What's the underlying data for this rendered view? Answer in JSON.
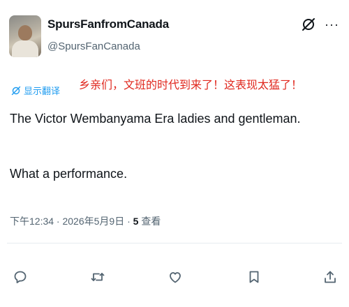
{
  "author": {
    "display_name": "SpursFanfromCanada",
    "handle": "@SpursFanCanada"
  },
  "top_icons": [
    "grok-icon",
    "more-options-icon"
  ],
  "more_label": "···",
  "translate_label": "显示翻译",
  "overlay_caption": "乡亲们，文班的时代到来了！这表现太猛了！",
  "tweet": {
    "line1": "The Victor Wembanyama Era ladies and gentleman.",
    "line2": "What a performance."
  },
  "meta": {
    "time_date": "下午12:34 · 2026年5月9日 · ",
    "views_count": "5",
    "views_label": " 查看"
  },
  "actions": [
    "reply-icon",
    "retweet-icon",
    "like-icon",
    "bookmark-icon",
    "share-icon"
  ],
  "colors": {
    "link": "#1d9bf0",
    "overlay_red": "#e0281e",
    "muted": "#536471",
    "text": "#0f1419"
  }
}
